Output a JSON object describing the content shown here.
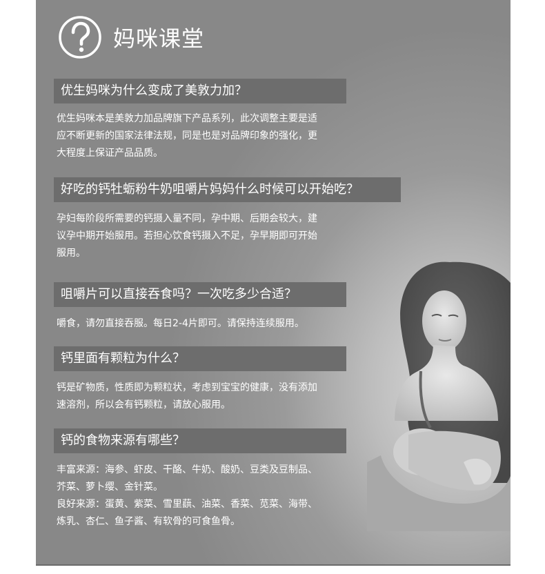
{
  "header": {
    "title": "妈咪课堂",
    "icon": "question-circle-icon"
  },
  "faqs": [
    {
      "question": "优生妈咪为什么变成了美敦力加？",
      "answer": [
        "优生妈咪本是美敦力加品牌旗下产品系列，此次调整主要是适",
        "应不断更新的国家法律法规，同是也是对品牌印象的强化，更",
        "大程度上保证产品品质。"
      ]
    },
    {
      "question": "好吃的钙牡蛎粉牛奶咀嚼片妈妈什么时候可以开始吃？",
      "answer": [
        "孕妇每阶段所需要的钙摄入量不同，孕中期、后期会较大，建",
        "议孕中期开始服用。若担心饮食钙摄入不足，孕早期即可开始",
        "服用。"
      ]
    },
    {
      "question": "咀嚼片可以直接吞食吗？一次吃多少合适？",
      "answer": [
        "嚼食，请勿直接吞服。每日2-4片即可。请保持连续服用。"
      ]
    },
    {
      "question": "钙里面有颗粒为什么？",
      "answer": [
        "钙是矿物质，性质即为颗粒状，考虑到宝宝的健康，没有添加",
        "速溶剂，所以会有钙颗粒，请放心服用。"
      ]
    },
    {
      "question": "钙的食物来源有哪些？",
      "answer": [
        "丰富来源：海参、虾皮、干酪、牛奶、酸奶、豆类及豆制品、",
        "芥菜、萝卜缨、金针菜。",
        "良好来源：蛋黄、紫菜、雪里蕻、油菜、香菜、苋菜、海带、",
        "炼乳、杏仁、鱼子酱、有软骨的可食鱼骨。"
      ]
    }
  ],
  "colors": {
    "panel": "#888888",
    "bar": "#6d6d6d",
    "text": "#ffffff"
  }
}
